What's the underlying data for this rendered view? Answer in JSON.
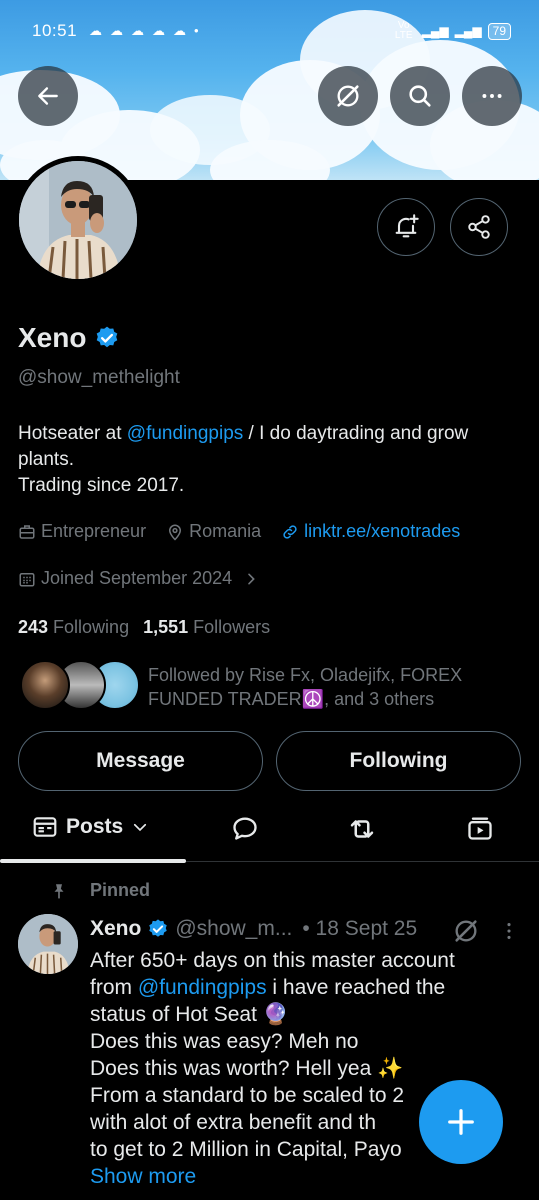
{
  "status_bar": {
    "time": "10:51",
    "network": "Vo LTE",
    "battery": "79"
  },
  "profile": {
    "name": "Xeno",
    "handle": "@show_methelight",
    "bio_line1_prefix": "Hotseater at ",
    "bio_mention": "@fundingpips",
    "bio_line1_suffix": " / I do daytrading and grow plants.",
    "bio_line2": "Trading since 2017.",
    "profession": "Entrepreneur",
    "location": "Romania",
    "website": "linktr.ee/xenotrades",
    "joined": "Joined September 2024",
    "following_count": "243",
    "following_label": "Following",
    "followers_count": "1,551",
    "followers_label": "Followers",
    "followed_by": "Followed by Rise Fx, Oladejifx, FOREX FUNDED TRADER☮️, and 3 others"
  },
  "actions": {
    "message": "Message",
    "following": "Following"
  },
  "tabs": {
    "posts": "Posts"
  },
  "pinned_post": {
    "pinned_label": "Pinned",
    "name": "Xeno",
    "handle": "@show_m...",
    "date": "• 18 Sept 25",
    "line1": "After 650+ days on this master account",
    "line2_prefix": "from ",
    "line2_mention": "@fundingpips",
    "line2_suffix": " i have reached the",
    "line3": "status of Hot Seat 🔮",
    "line4": "Does this was easy? Meh no",
    "line5": "Does this was worth? Hell yea ✨",
    "line6": "From a standard to be scaled to 2",
    "line7": "with alot of extra benefit and th",
    "line8": "to get to 2 Million in Capital, Payo",
    "show_more": "Show more"
  },
  "colors": {
    "accent": "#1d9bf0",
    "muted": "#71767b",
    "text": "#e7e9ea",
    "background": "#000000"
  }
}
